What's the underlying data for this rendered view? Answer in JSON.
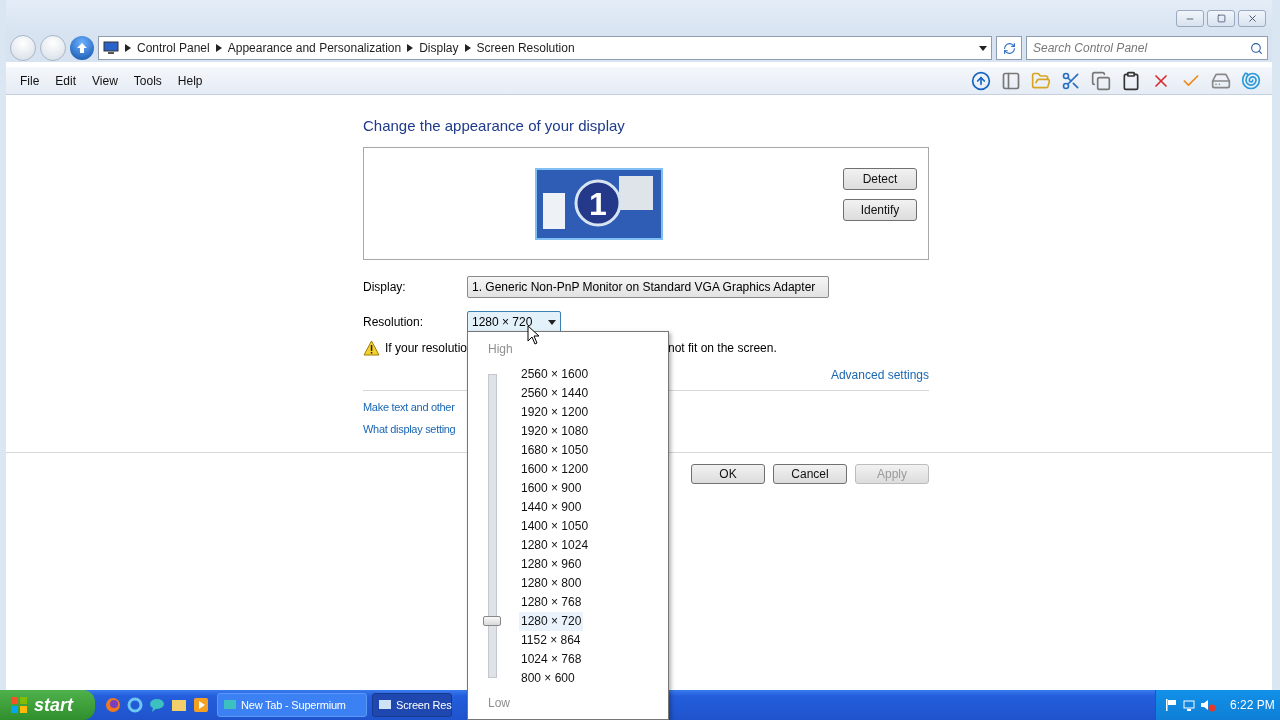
{
  "address_bar": {
    "breadcrumbs": [
      "Control Panel",
      "Appearance and Personalization",
      "Display",
      "Screen Resolution"
    ]
  },
  "search": {
    "placeholder": "Search Control Panel"
  },
  "menu": [
    "File",
    "Edit",
    "View",
    "Tools",
    "Help"
  ],
  "heading": "Change the appearance of your display",
  "monitor": {
    "number": "1"
  },
  "side_buttons": [
    "Detect",
    "Identify"
  ],
  "display": {
    "label": "Display:",
    "value": "1. Generic Non-PnP Monitor on Standard VGA Graphics Adapter"
  },
  "resolution": {
    "label": "Resolution:",
    "value": "1280 × 720",
    "expanded": true
  },
  "warning": {
    "text_start": "If your resolutio",
    "text_end": "not fit on the screen."
  },
  "advanced_link": "Advanced settings",
  "links": [
    "Make text and other",
    "What display setting"
  ],
  "dialog_buttons": [
    {
      "label": "OK",
      "disabled": false
    },
    {
      "label": "Cancel",
      "disabled": false
    },
    {
      "label": "Apply",
      "disabled": true
    }
  ],
  "resolution_popup": {
    "high_label": "High",
    "low_label": "Low",
    "level": 0.1875,
    "options": [
      {
        "label": "2560 × 1600",
        "selected": false
      },
      {
        "label": "2560 × 1440",
        "selected": false
      },
      {
        "label": "1920 × 1200",
        "selected": false
      },
      {
        "label": "1920 × 1080",
        "selected": false
      },
      {
        "label": "1680 × 1050",
        "selected": false
      },
      {
        "label": "1600 × 1200",
        "selected": false
      },
      {
        "label": "1600 × 900",
        "selected": false
      },
      {
        "label": "1440 × 900",
        "selected": false
      },
      {
        "label": "1400 × 1050",
        "selected": false
      },
      {
        "label": "1280 × 1024",
        "selected": false
      },
      {
        "label": "1280 × 960",
        "selected": false
      },
      {
        "label": "1280 × 800",
        "selected": false
      },
      {
        "label": "1280 × 768",
        "selected": false
      },
      {
        "label": "1280 × 720",
        "selected": true
      },
      {
        "label": "1152 × 864",
        "selected": false
      },
      {
        "label": "1024 × 768",
        "selected": false
      },
      {
        "label": "800 × 600",
        "selected": false
      }
    ]
  },
  "taskbar": {
    "start": "start",
    "tasks": [
      {
        "label": "New Tab - Supermium",
        "selected": false
      },
      {
        "label": "Screen Res",
        "selected": true
      }
    ],
    "clock": "6:22 PM"
  }
}
